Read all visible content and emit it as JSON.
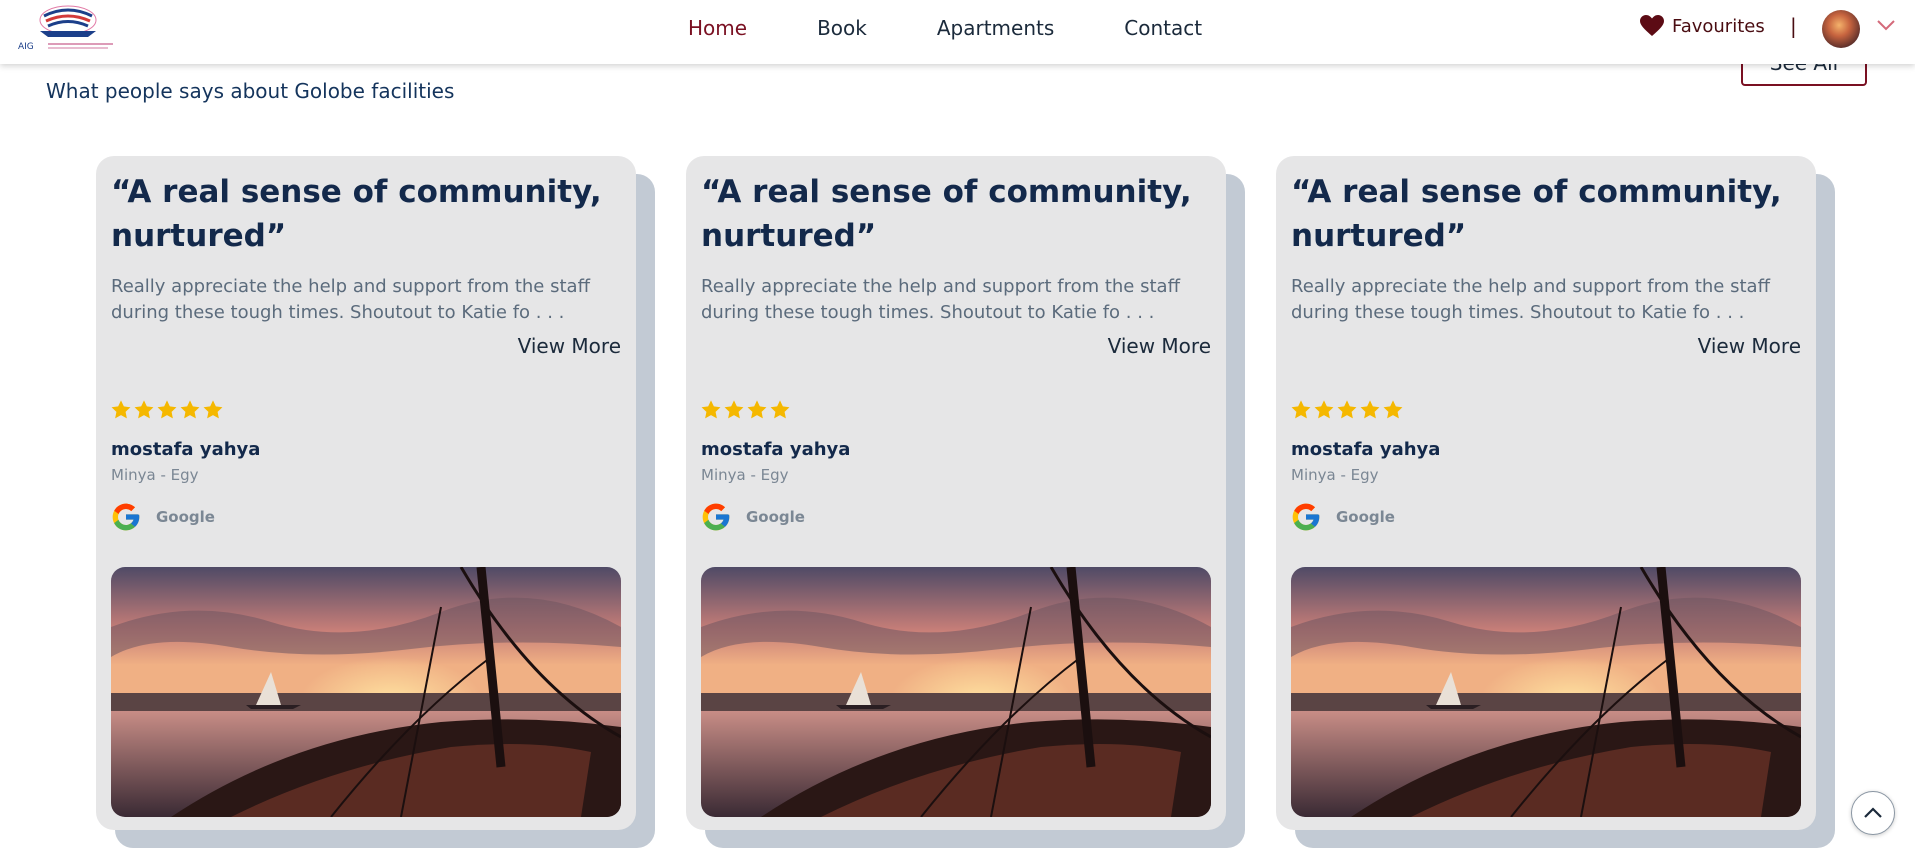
{
  "nav": {
    "logo_text": "AIG",
    "links": [
      "Home",
      "Book",
      "Apartments",
      "Contact"
    ],
    "active_index": 0,
    "favourites_label": "Favourites",
    "separator": "|",
    "avatar_icon": "user-avatar"
  },
  "section": {
    "see_all_label": "See All",
    "subtitle": "What people says about Golobe facilities"
  },
  "reviews": [
    {
      "quote": "“A real sense of community, nurtured”",
      "text": "Really appreciate the help and support from the staff during these tough times. Shoutout to Katie fo . . .",
      "view_more": "View More",
      "rating": 5,
      "name": "mostafa yahya",
      "location": "Minya - Egy",
      "source": "Google"
    },
    {
      "quote": "“A real sense of community, nurtured”",
      "text": "Really appreciate the help and support from the staff during these tough times. Shoutout to Katie fo . . .",
      "view_more": "View More",
      "rating": 4,
      "name": "mostafa yahya",
      "location": "Minya - Egy",
      "source": "Google"
    },
    {
      "quote": "“A real sense of community, nurtured”",
      "text": "Really appreciate the help and support from the staff during these tough times. Shoutout to Katie fo . . .",
      "view_more": "View More",
      "rating": 5,
      "name": "mostafa yahya",
      "location": "Minya - Egy",
      "source": "Google"
    }
  ],
  "colors": {
    "accent": "#7a1022",
    "navy": "#13294b",
    "card_bg": "#e6e6e7",
    "card_shadow": "#c2cad4",
    "star": "#f5b800"
  },
  "icons": {
    "favourite": "heart-icon",
    "dropdown": "chevron-down-icon",
    "source": "google-icon",
    "scroll": "chevron-up-icon"
  }
}
